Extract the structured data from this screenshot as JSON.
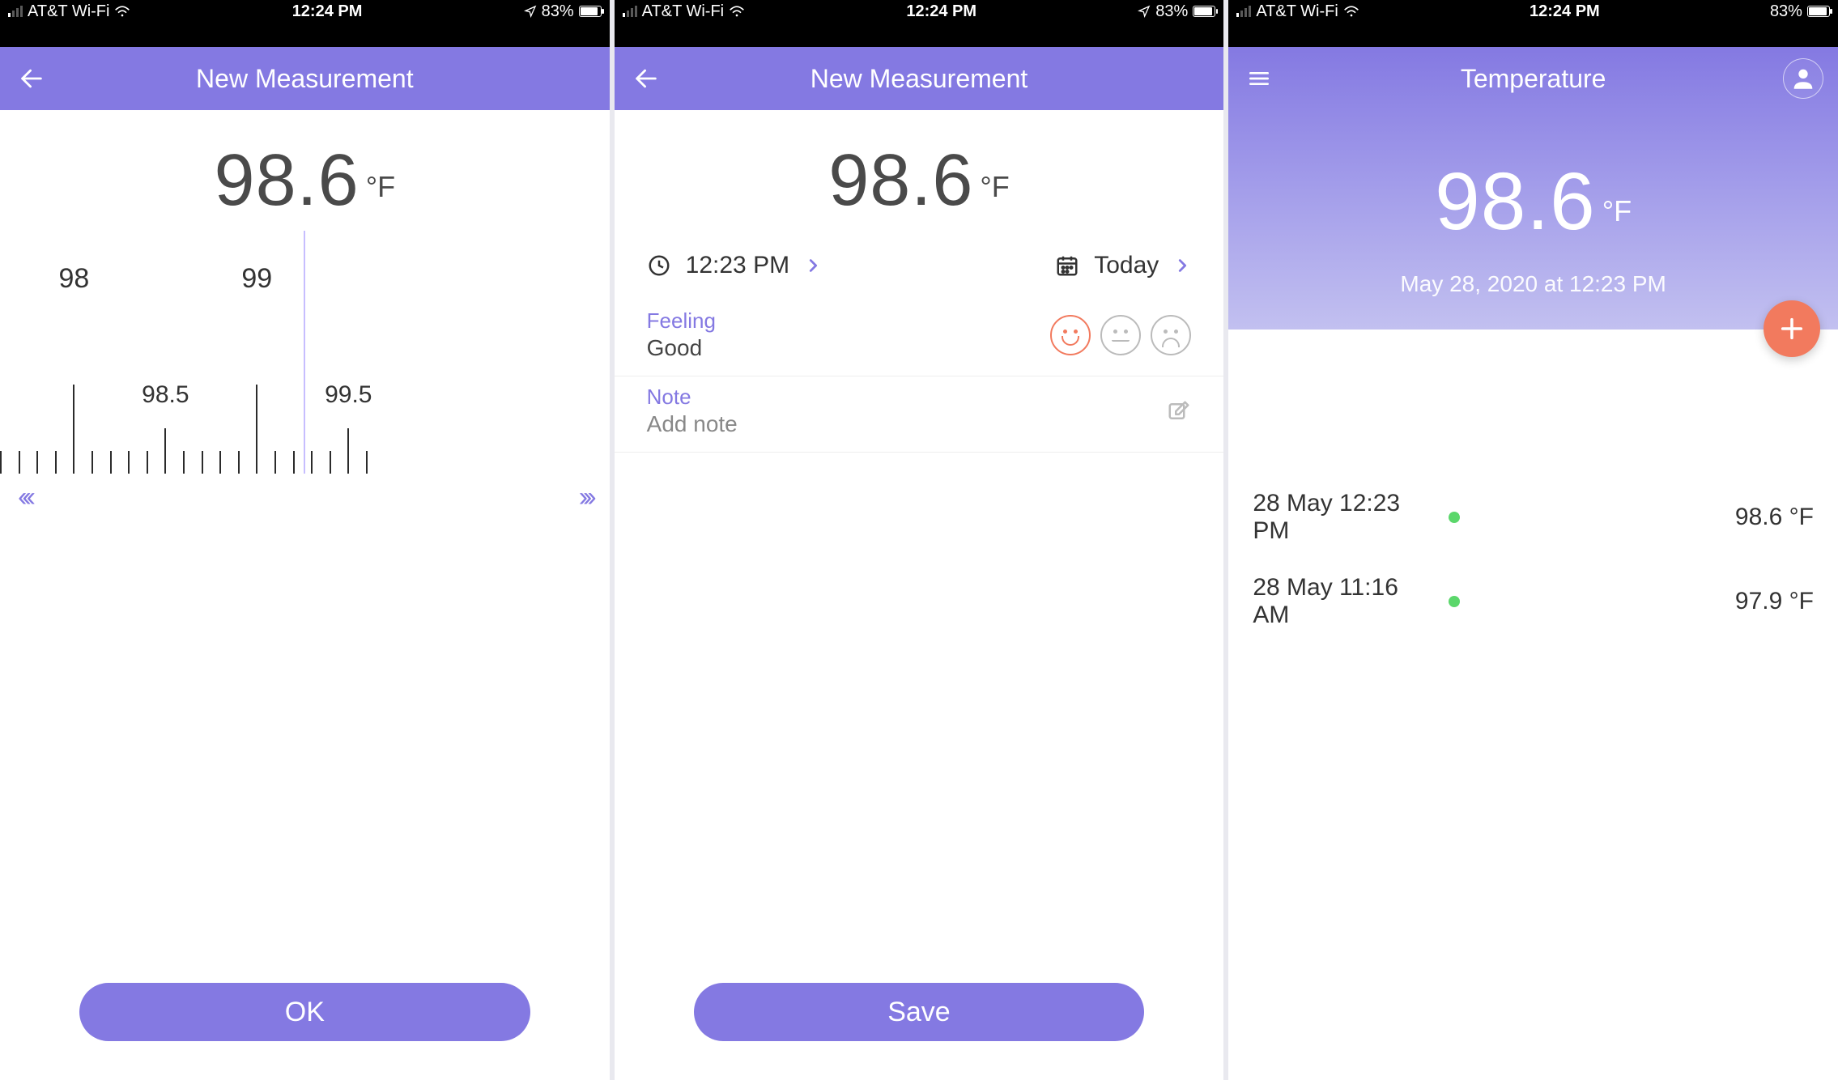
{
  "status": {
    "carrier": "AT&T Wi-Fi",
    "time": "12:24 PM",
    "battery_pct": "83%"
  },
  "screen1": {
    "title": "New Measurement",
    "temp_value": "98.6",
    "temp_unit": "°F",
    "ruler": {
      "major_labels": [
        "98",
        "99"
      ],
      "mid_labels": [
        "98.5",
        "99.5"
      ]
    },
    "ok_label": "OK"
  },
  "screen2": {
    "title": "New Measurement",
    "temp_value": "98.6",
    "temp_unit": "°F",
    "time_value": "12:23 PM",
    "date_value": "Today",
    "feeling_label": "Feeling",
    "feeling_value": "Good",
    "note_label": "Note",
    "note_placeholder": "Add note",
    "save_label": "Save"
  },
  "screen3": {
    "title": "Temperature",
    "temp_value": "98.6",
    "temp_unit": "°F",
    "timestamp": "May 28, 2020 at 12:23 PM",
    "history": [
      {
        "date": "28 May 12:23 PM",
        "status": "ok",
        "value": "98.6 °F"
      },
      {
        "date": "28 May 11:16 AM",
        "status": "ok",
        "value": "97.9 °F"
      }
    ]
  }
}
